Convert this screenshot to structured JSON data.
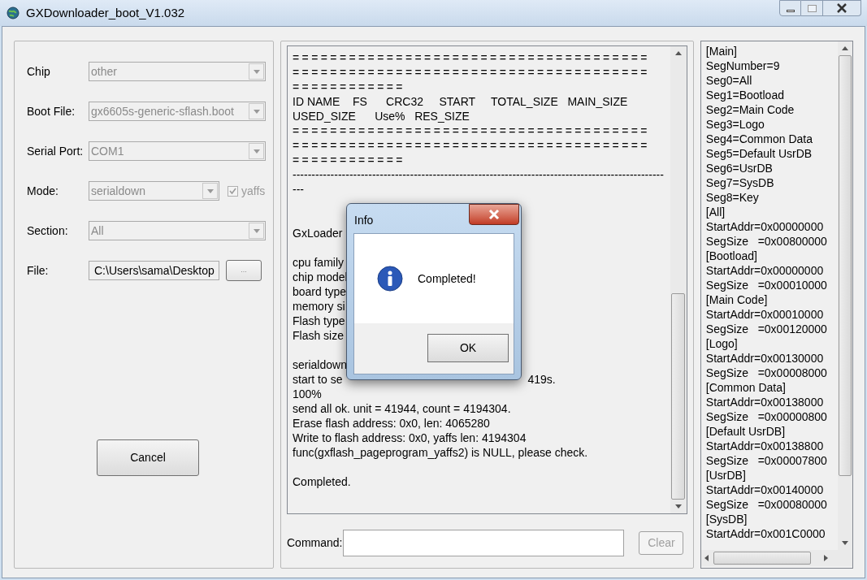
{
  "window": {
    "title": "GXDownloader_boot_V1.032"
  },
  "settings": [
    {
      "label": "Chip",
      "kind": "combo",
      "value": "other",
      "disabled": true
    },
    {
      "label": "Boot File:",
      "kind": "combo",
      "value": "gx6605s-generic-sflash.boot",
      "disabled": true
    },
    {
      "label": "Serial Port:",
      "kind": "combo",
      "value": "COM1",
      "disabled": true
    },
    {
      "label": "Mode:",
      "kind": "combo_check",
      "value": "serialdown",
      "disabled": true,
      "check": {
        "label": "yaffs",
        "checked": true,
        "disabled": true
      }
    },
    {
      "label": "Section:",
      "kind": "combo",
      "value": "All",
      "disabled": true
    },
    {
      "label": "File:",
      "kind": "file",
      "value": "C:\\Users\\sama\\Desktop",
      "disabled": false,
      "browse": "..."
    }
  ],
  "cancel_button": "Cancel",
  "log": [
    {
      "kind": "rule",
      "text": "======================================"
    },
    {
      "kind": "rule",
      "text": "======================================"
    },
    {
      "kind": "rule",
      "text": "============"
    },
    {
      "kind": "text",
      "text": "ID NAME    FS      CRC32     START     TOTAL_SIZE   MAIN_SIZE"
    },
    {
      "kind": "text",
      "text": "USED_SIZE      Use%   RES_SIZE"
    },
    {
      "kind": "rule",
      "text": "======================================"
    },
    {
      "kind": "rule",
      "text": "======================================"
    },
    {
      "kind": "rule",
      "text": "============"
    },
    {
      "kind": "text",
      "text": "--------------------------------------------------------------------------------------------------"
    },
    {
      "kind": "text",
      "text": "---"
    },
    {
      "kind": "blank"
    },
    {
      "kind": "blank"
    },
    {
      "kind": "text",
      "text": "GxLoader"
    },
    {
      "kind": "blank"
    },
    {
      "kind": "text",
      "text": "cpu family"
    },
    {
      "kind": "text",
      "text": "chip model"
    },
    {
      "kind": "text",
      "text": "board type"
    },
    {
      "kind": "text",
      "text": "memory si"
    },
    {
      "kind": "text",
      "text": "Flash type"
    },
    {
      "kind": "text",
      "text": "Flash size"
    },
    {
      "kind": "blank"
    },
    {
      "kind": "text",
      "text": "serialdown"
    },
    {
      "kind": "split",
      "text": "start to se",
      "tail": "419s."
    },
    {
      "kind": "text",
      "text": "100%"
    },
    {
      "kind": "text",
      "text": "send all ok. unit = 41944, count = 4194304."
    },
    {
      "kind": "text",
      "text": "Erase flash address: 0x0, len: 4065280"
    },
    {
      "kind": "text",
      "text": "Write to flash address: 0x0, yaffs len: 4194304"
    },
    {
      "kind": "text",
      "text": "func(gxflash_pageprogram_yaffs2) is NULL, please check."
    },
    {
      "kind": "blank"
    },
    {
      "kind": "text",
      "text": "Completed."
    }
  ],
  "command": {
    "label": "Command:",
    "clear_button": "Clear",
    "clear_disabled": true
  },
  "config_lines": [
    "[Main]",
    "SegNumber=9",
    "Seg0=All",
    "Seg1=Bootload",
    "Seg2=Main Code",
    "Seg3=Logo",
    "Seg4=Common Data",
    "Seg5=Default UsrDB",
    "Seg6=UsrDB",
    "Seg7=SysDB",
    "Seg8=Key",
    "[All]",
    "StartAddr=0x00000000",
    "SegSize   =0x00800000",
    "[Bootload]",
    "StartAddr=0x00000000",
    "SegSize   =0x00010000",
    "[Main Code]",
    "StartAddr=0x00010000",
    "SegSize   =0x00120000",
    "[Logo]",
    "StartAddr=0x00130000",
    "SegSize   =0x00008000",
    "[Common Data]",
    "StartAddr=0x00138000",
    "SegSize   =0x00000800",
    "[Default UsrDB]",
    "StartAddr=0x00138800",
    "SegSize   =0x00007800",
    "[UsrDB]",
    "StartAddr=0x00140000",
    "SegSize   =0x00080000",
    "[SysDB]",
    "StartAddr=0x001C0000"
  ],
  "dialog": {
    "title": "Info",
    "message": "Completed!",
    "button": "OK"
  }
}
